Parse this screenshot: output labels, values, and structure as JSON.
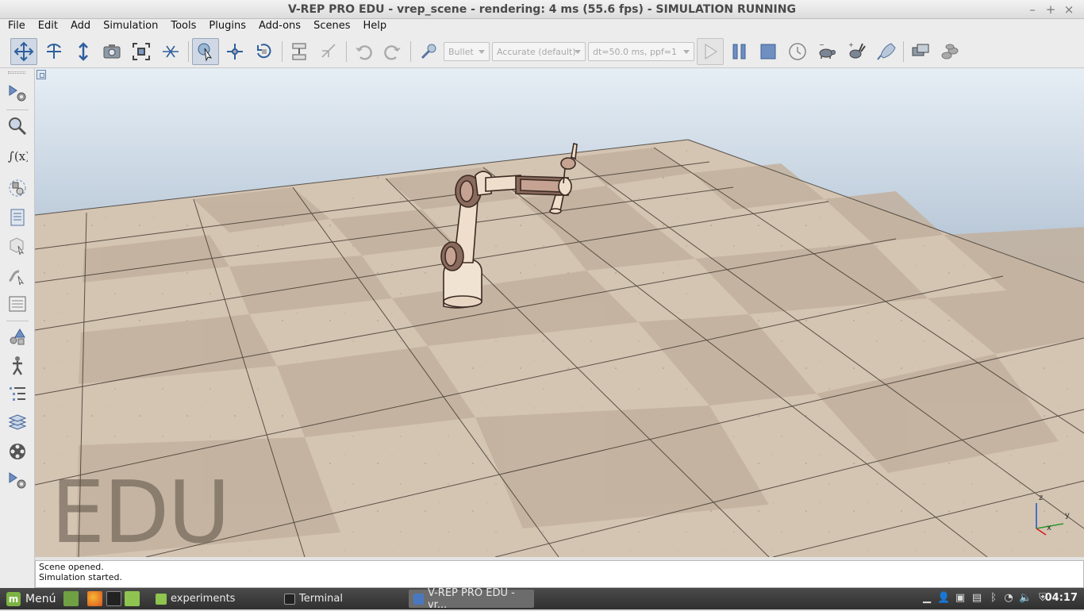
{
  "window": {
    "title": "V-REP PRO EDU - vrep_scene - rendering: 4 ms (55.6 fps) - SIMULATION RUNNING",
    "minimize": "–",
    "maximize": "+",
    "close": "×"
  },
  "menubar": {
    "items": [
      "File",
      "Edit",
      "Add",
      "Simulation",
      "Tools",
      "Plugins",
      "Add-ons",
      "Scenes",
      "Help"
    ]
  },
  "toolbar": {
    "engine": "Bullet",
    "accuracy": "Accurate (default)",
    "timestep": "dt=50.0 ms, ppf=1"
  },
  "viewport": {
    "watermark": "EDU",
    "axis_z": "z",
    "axis_y": "y",
    "axis_x": "x",
    "colors": {
      "floor_light": "#d6c7b6",
      "floor_dark": "#c4b3a1",
      "sky_top": "#e6eef5",
      "sky_bottom": "#7d93ad"
    }
  },
  "status": {
    "lines": [
      "Scene opened.",
      "Simulation started."
    ]
  },
  "taskbar": {
    "menu_label": "Menú",
    "tasks": [
      "experiments",
      "Terminal",
      "V-REP PRO EDU - vr..."
    ],
    "clock": "04:17"
  }
}
